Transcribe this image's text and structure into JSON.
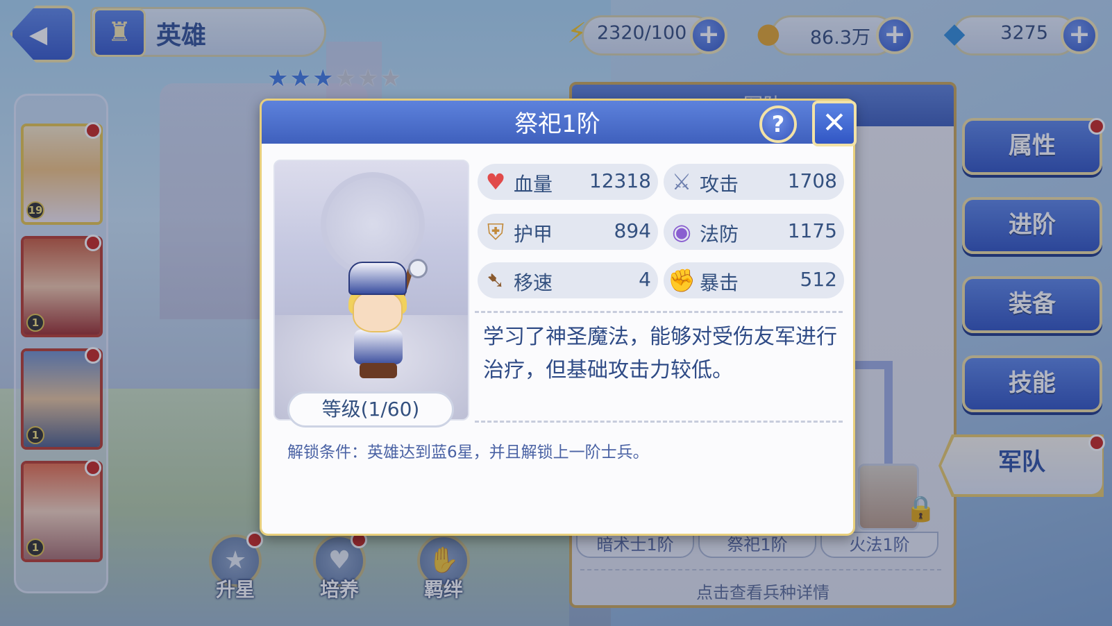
{
  "header": {
    "title": "英雄",
    "stamina": "2320/100",
    "gold": "86.3万",
    "gems": "3275",
    "plus": "+"
  },
  "stars": {
    "filled": 3,
    "total": 6
  },
  "heroes": [
    {
      "level": "19",
      "selected": true
    },
    {
      "level": "1"
    },
    {
      "level": "1"
    },
    {
      "level": "1"
    }
  ],
  "bottom_buttons": [
    "升星",
    "培养",
    "羁绊"
  ],
  "right_tabs": [
    "属性",
    "进阶",
    "装备",
    "技能",
    "军队"
  ],
  "army_panel": {
    "header": "军队",
    "unit_tabs": [
      "暗术士1阶",
      "祭祀1阶",
      "火法1阶"
    ],
    "hint": "点击查看兵种详情"
  },
  "modal": {
    "title": "祭祀1阶",
    "help": "?",
    "close": "✕",
    "level": "等级(1/60)",
    "stats": [
      {
        "name": "血量",
        "value": "12318",
        "icon": "heart-icon"
      },
      {
        "name": "攻击",
        "value": "1708",
        "icon": "sword-icon"
      },
      {
        "name": "护甲",
        "value": "894",
        "icon": "armor-icon"
      },
      {
        "name": "法防",
        "value": "1175",
        "icon": "magic-shield-icon"
      },
      {
        "name": "移速",
        "value": "4",
        "icon": "boot-icon"
      },
      {
        "name": "暴击",
        "value": "512",
        "icon": "fist-icon"
      }
    ],
    "description": "学习了神圣魔法，能够对受伤友军进行治疗，但基础攻击力较低。",
    "unlock": "解锁条件：英雄达到蓝6星，并且解锁上一阶士兵。"
  }
}
